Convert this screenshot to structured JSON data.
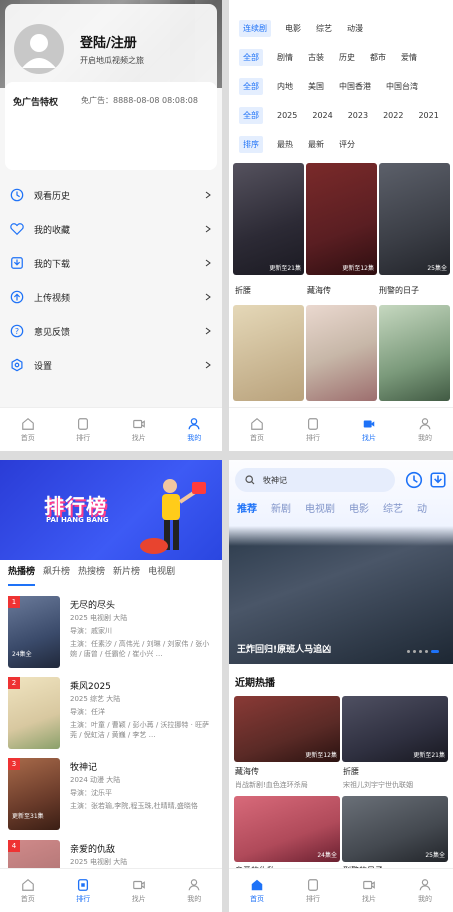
{
  "tabbar": [
    {
      "label": "首页",
      "icon": "home-icon"
    },
    {
      "label": "排行",
      "icon": "rank-icon"
    },
    {
      "label": "找片",
      "icon": "video-icon"
    },
    {
      "label": "我的",
      "icon": "user-icon"
    }
  ],
  "profile": {
    "login_title": "登陆/注册",
    "login_sub": "开启地瓜视频之旅",
    "ad_title": "免广告特权",
    "ad_expiry": "免广告：8888-08-08 08:08:08",
    "menu": [
      {
        "label": "观看历史",
        "icon": "history-icon"
      },
      {
        "label": "我的收藏",
        "icon": "favorite-icon"
      },
      {
        "label": "我的下载",
        "icon": "download-icon"
      },
      {
        "label": "上传视频",
        "icon": "upload-icon"
      },
      {
        "label": "意见反馈",
        "icon": "feedback-icon"
      },
      {
        "label": "设置",
        "icon": "settings-icon"
      }
    ]
  },
  "filter": {
    "rows": [
      [
        "连续剧",
        "电影",
        "综艺",
        "动漫"
      ],
      [
        "全部",
        "剧情",
        "古装",
        "历史",
        "都市",
        "爱情"
      ],
      [
        "全部",
        "内地",
        "美国",
        "中国香港",
        "中国台湾"
      ],
      [
        "全部",
        "2025",
        "2024",
        "2023",
        "2022",
        "2021"
      ],
      [
        "排序",
        "最热",
        "最新",
        "评分"
      ]
    ],
    "items": [
      {
        "name": "折腰",
        "update": "更新至21集",
        "color": "#2c2a35"
      },
      {
        "name": "藏海传",
        "update": "更新至12集",
        "color": "#5a1e22"
      },
      {
        "name": "刑警的日子",
        "update": "25集全",
        "color": "#3b3e46"
      },
      {
        "name": "",
        "update": "",
        "color": "#b9a27c"
      },
      {
        "name": "",
        "update": "",
        "color": "#c7b7a8"
      },
      {
        "name": "",
        "update": "",
        "color": "#7b9a7b"
      }
    ]
  },
  "rank": {
    "banner_title": "排行榜",
    "banner_sub": "PAI HANG BANG",
    "tabs": [
      "热播榜",
      "飙升榜",
      "热搜榜",
      "新片榜",
      "电视剧"
    ],
    "items": [
      {
        "no": "1",
        "title": "无尽的尽头",
        "meta": "2025  电视剧  大陆",
        "director": "导演：戚家川",
        "actors": "主演：任素汐 / 高伟光 / 刘琳 / 刘家伟 / 张小婉 / 唐曾 / 任霸伦 / 崔小兴 …",
        "update": "24集全",
        "color": "#3a4a6a"
      },
      {
        "no": "2",
        "title": "乘风2025",
        "meta": "2025  综艺  大陆",
        "director": "导演：任洋",
        "actors": "主演：叶童 / 曹颖 / 彭小苒 / 沃拉挪特 · 旺萨莞 / 倪虹洁 / 黄巍 / 李艺 …",
        "update": "",
        "color": "#d8c8a0"
      },
      {
        "no": "3",
        "title": "牧神记",
        "meta": "2024  动漫  大陆",
        "director": "导演：沈乐平",
        "actors": "主演：张若瑜,李院,程玉珠,杜晴晴,盛晓恪",
        "update": "更新至31集",
        "color": "#6a3b2a"
      },
      {
        "no": "4",
        "title": "亲爱的仇敌",
        "meta": "2025  电视剧  大陆",
        "director": "",
        "actors": "",
        "update": "",
        "color": "#a06a6a"
      }
    ]
  },
  "home": {
    "search": "牧神记",
    "tabs": [
      "推荐",
      "新剧",
      "电视剧",
      "电影",
      "综艺",
      "动"
    ],
    "hero_caption": "王炸回归!原班人马追凶",
    "section": "近期热播",
    "cards": [
      {
        "name": "藏海传",
        "sub": "肖战新剧!血色连环杀局",
        "update": "更新至12集",
        "color": "#5a2a26"
      },
      {
        "name": "折腰",
        "sub": "宋祖儿刘宇宁世仇联姻",
        "update": "更新至21集",
        "color": "#2f3040"
      },
      {
        "name": "亲爱的仇敌",
        "sub": "",
        "update": "24集全",
        "color": "#b04a5a"
      },
      {
        "name": "刑警的日子",
        "sub": "",
        "update": "25集全",
        "color": "#444950"
      }
    ]
  }
}
